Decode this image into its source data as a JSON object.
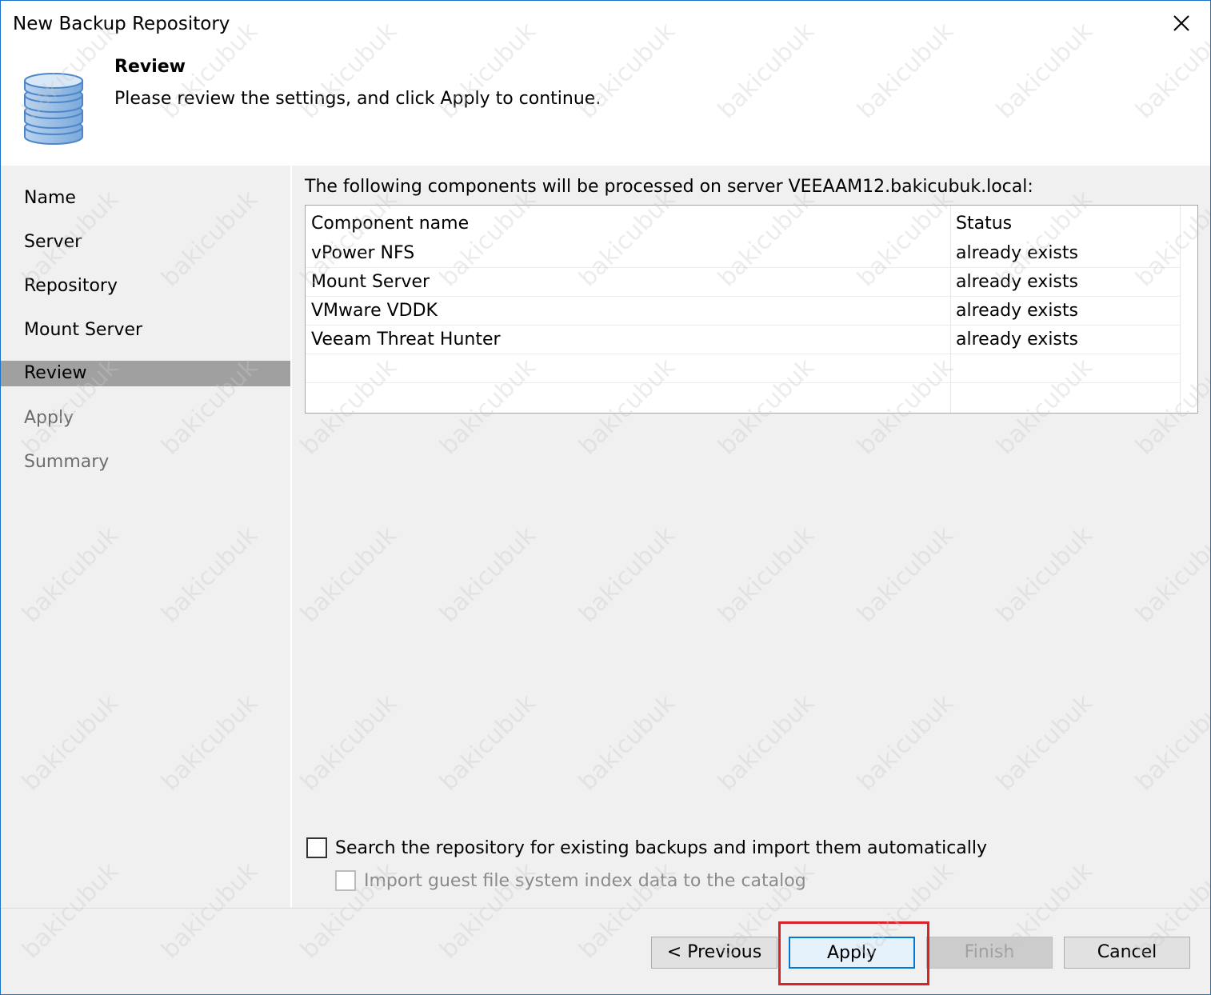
{
  "window": {
    "title": "New Backup Repository"
  },
  "header": {
    "title": "Review",
    "subtitle": "Please review the settings, and click Apply to continue.",
    "icon": "database-icon"
  },
  "sidebar": {
    "items": [
      {
        "label": "Name",
        "state": "done"
      },
      {
        "label": "Server",
        "state": "done"
      },
      {
        "label": "Repository",
        "state": "done"
      },
      {
        "label": "Mount Server",
        "state": "done"
      },
      {
        "label": "Review",
        "state": "active"
      },
      {
        "label": "Apply",
        "state": "disabled"
      },
      {
        "label": "Summary",
        "state": "disabled"
      }
    ]
  },
  "main": {
    "intro": "The following components will be processed on server VEEAAM12.bakicubuk.local:",
    "table": {
      "headers": [
        "Component name",
        "Status"
      ],
      "rows": [
        [
          "vPower NFS",
          "already exists"
        ],
        [
          "Mount Server",
          "already exists"
        ],
        [
          "VMware VDDK",
          "already exists"
        ],
        [
          "Veeam Threat Hunter",
          "already exists"
        ]
      ]
    },
    "options": {
      "search_backups": {
        "label": "Search the repository for existing backups and import them automatically",
        "checked": false
      },
      "import_index": {
        "label": "Import guest file system index data to the catalog",
        "checked": false,
        "enabled": false
      }
    }
  },
  "footer": {
    "previous_label": "< Previous",
    "apply_label": "Apply",
    "finish_label": "Finish",
    "cancel_label": "Cancel"
  },
  "watermark": "bakicubuk",
  "colors": {
    "accent": "#0078d7",
    "highlight": "#d8232a",
    "active_step": "#a0a0a0"
  }
}
